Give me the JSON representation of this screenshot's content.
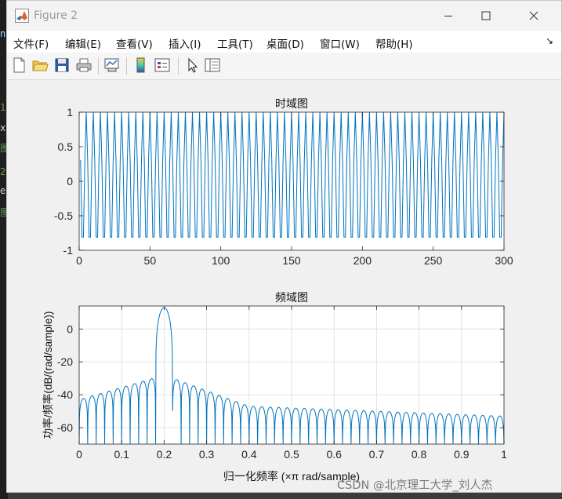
{
  "window": {
    "title": "Figure 2"
  },
  "background_code": [
    {
      "text": "n",
      "color": "#9cdcfe"
    },
    {
      "text": "1)",
      "color": "#6a9955"
    },
    {
      "text": "x(",
      "color": "#d4d4d4"
    },
    {
      "text": "图",
      "color": "#6a9955"
    },
    {
      "text": "2)",
      "color": "#6a9955"
    },
    {
      "text": "er",
      "color": "#d4d4d4"
    },
    {
      "text": "图",
      "color": "#6a9955"
    }
  ],
  "menu": [
    {
      "label": "文件(F)"
    },
    {
      "label": "编辑(E)"
    },
    {
      "label": "查看(V)"
    },
    {
      "label": "插入(I)"
    },
    {
      "label": "工具(T)"
    },
    {
      "label": "桌面(D)"
    },
    {
      "label": "窗口(W)"
    },
    {
      "label": "帮助(H)"
    }
  ],
  "toolbar": [
    {
      "name": "new-figure-icon"
    },
    {
      "name": "open-file-icon"
    },
    {
      "name": "save-icon"
    },
    {
      "name": "print-icon"
    },
    {
      "name": "link-plot-icon"
    },
    {
      "name": "insert-colorbar-icon"
    },
    {
      "name": "insert-legend-icon"
    },
    {
      "name": "pointer-icon"
    },
    {
      "name": "property-inspector-icon"
    }
  ],
  "chart_data": [
    {
      "type": "line",
      "title": "时域图",
      "xlabel": "",
      "ylabel": "",
      "xlim": [
        0,
        300
      ],
      "ylim": [
        -1,
        1
      ],
      "xticks": [
        0,
        50,
        100,
        150,
        200,
        250,
        300
      ],
      "yticks": [
        -1,
        -0.5,
        0,
        0.5,
        1
      ],
      "xtick_labels": [
        "0",
        "50",
        "100",
        "150",
        "200",
        "250",
        "300"
      ],
      "ytick_labels": [
        "-1",
        "-0.5",
        "0",
        "0.5",
        "1"
      ],
      "grid": false,
      "series": [
        {
          "signal": "cosine",
          "normalized_frequency": 0.2,
          "amplitude": 1,
          "phase": 0,
          "n_start": 1,
          "n_end": 300,
          "color": "#0072bd"
        }
      ]
    },
    {
      "type": "line",
      "title": "频域图",
      "xlabel": "归一化频率  (×π rad/sample)",
      "ylabel": "功率/频率(dB/(rad/sample))",
      "xlim": [
        0,
        1
      ],
      "ylim": [
        -70,
        14
      ],
      "xticks": [
        0,
        0.1,
        0.2,
        0.3,
        0.4,
        0.5,
        0.6,
        0.7,
        0.8,
        0.9,
        1
      ],
      "yticks": [
        -60,
        -40,
        -20,
        0
      ],
      "xtick_labels": [
        "0",
        "0.1",
        "0.2",
        "0.3",
        "0.4",
        "0.5",
        "0.6",
        "0.7",
        "0.8",
        "0.9",
        "1"
      ],
      "ytick_labels": [
        "-60",
        "-40",
        "-20",
        "0"
      ],
      "grid": true,
      "series": [
        {
          "color": "#0072bd",
          "peak_frequency": 0.2,
          "peak_value": 13,
          "sidelobe_envelope": {
            "x": [
              0.0,
              0.2,
              0.4,
              1.0
            ],
            "y": [
              -43,
              -28,
              -47,
              -53
            ]
          },
          "null_spacing": 0.02,
          "null_floor": -70
        }
      ]
    }
  ],
  "watermark": "CSDN @北京理工大学_刘人杰"
}
